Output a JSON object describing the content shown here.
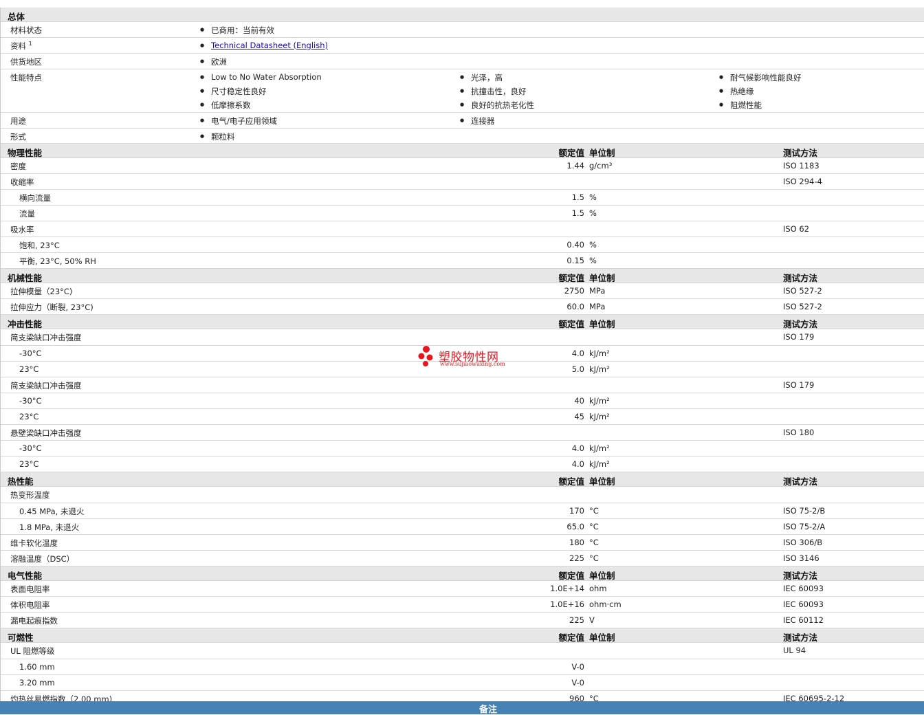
{
  "general": {
    "title": "总体",
    "status_label": "材料状态",
    "status_value": "已商用：当前有效",
    "source_label": "资料",
    "source_sup": "1",
    "source_link": "Technical Datasheet (English)",
    "region_label": "供货地区",
    "region_value": "欧洲",
    "features_label": "性能特点",
    "features": [
      "Low to No Water Absorption",
      "光泽，高",
      "耐气候影响性能良好",
      "尺寸稳定性良好",
      "抗撞击性，良好",
      "热绝缘",
      "低摩擦系数",
      "良好的抗热老化性",
      "阻燃性能"
    ],
    "uses_label": "用途",
    "uses": [
      "电气/电子应用领域",
      "连接器"
    ],
    "form_label": "形式",
    "form_value": "颗粒料"
  },
  "headers": {
    "value": "额定值",
    "unit": "单位制",
    "method": "测试方法"
  },
  "sections": {
    "physical": {
      "title": "物理性能",
      "rows": [
        {
          "label": "密度",
          "value": "1.44",
          "unit": "g/cm³",
          "method": "ISO 1183"
        },
        {
          "label": "收缩率",
          "value": "",
          "unit": "",
          "method": "ISO 294-4"
        },
        {
          "label": "横向流量",
          "value": "1.5",
          "unit": "%",
          "method": ""
        },
        {
          "label": "流量",
          "value": "1.5",
          "unit": "%",
          "method": ""
        },
        {
          "label": "吸水率",
          "value": "",
          "unit": "",
          "method": "ISO 62"
        },
        {
          "label": "饱和, 23°C",
          "value": "0.40",
          "unit": "%",
          "method": ""
        },
        {
          "label": "平衡, 23°C, 50% RH",
          "value": "0.15",
          "unit": "%",
          "method": ""
        }
      ]
    },
    "mechanical": {
      "title": "机械性能",
      "rows": [
        {
          "label": "拉伸模量（23°C)",
          "value": "2750",
          "unit": "MPa",
          "method": "ISO 527-2"
        },
        {
          "label": "拉伸应力（断裂, 23°C)",
          "value": "60.0",
          "unit": "MPa",
          "method": "ISO 527-2"
        }
      ]
    },
    "impact": {
      "title": "冲击性能",
      "rows": [
        {
          "label": "简支梁缺口冲击强度",
          "value": "",
          "unit": "",
          "method": "ISO 179"
        },
        {
          "label": "-30°C",
          "value": "4.0",
          "unit": "kJ/m²",
          "method": ""
        },
        {
          "label": "23°C",
          "value": "5.0",
          "unit": "kJ/m²",
          "method": ""
        },
        {
          "label": "简支梁缺口冲击强度",
          "value": "",
          "unit": "",
          "method": "ISO 179"
        },
        {
          "label": "-30°C",
          "value": "40",
          "unit": "kJ/m²",
          "method": ""
        },
        {
          "label": "23°C",
          "value": "45",
          "unit": "kJ/m²",
          "method": ""
        },
        {
          "label": "悬壁梁缺口冲击强度",
          "value": "",
          "unit": "",
          "method": "ISO 180"
        },
        {
          "label": "-30°C",
          "value": "4.0",
          "unit": "kJ/m²",
          "method": ""
        },
        {
          "label": "23°C",
          "value": "4.0",
          "unit": "kJ/m²",
          "method": ""
        }
      ]
    },
    "thermal": {
      "title": "热性能",
      "rows": [
        {
          "label": "热变形温度",
          "value": "",
          "unit": "",
          "method": ""
        },
        {
          "label": "0.45 MPa, 未退火",
          "value": "170",
          "unit": "°C",
          "method": "ISO 75-2/B"
        },
        {
          "label": "1.8 MPa, 未退火",
          "value": "65.0",
          "unit": "°C",
          "method": "ISO 75-2/A"
        },
        {
          "label": "维卡软化温度",
          "value": "180",
          "unit": "°C",
          "method": "ISO 306/B"
        },
        {
          "label": "溶融温度（DSC）",
          "value": "225",
          "unit": "°C",
          "method": "ISO 3146"
        }
      ]
    },
    "electrical": {
      "title": "电气性能",
      "rows": [
        {
          "label": "表面电阻率",
          "value": "1.0E+14",
          "unit": "ohm",
          "method": "IEC 60093"
        },
        {
          "label": "体积电阻率",
          "value": "1.0E+16",
          "unit": "ohm·cm",
          "method": "IEC 60093"
        },
        {
          "label": "漏电起痕指数",
          "value": "225",
          "unit": "V",
          "method": "IEC 60112"
        }
      ]
    },
    "flammability": {
      "title": "可燃性",
      "rows": [
        {
          "label": "UL 阻燃等级",
          "value": "",
          "unit": "",
          "method": "UL 94"
        },
        {
          "label": "1.60 mm",
          "value": "V-0",
          "unit": "",
          "method": ""
        },
        {
          "label": "3.20 mm",
          "value": "V-0",
          "unit": "",
          "method": ""
        },
        {
          "label": "灼热丝易燃指数（2.00 mm)",
          "value": "960",
          "unit": "°C",
          "method": "IEC 60695-2-12"
        }
      ]
    }
  },
  "footer": {
    "title": "备注"
  },
  "watermark": {
    "name": "塑胶物性网",
    "url": "www.sujiaowuxing.com"
  }
}
